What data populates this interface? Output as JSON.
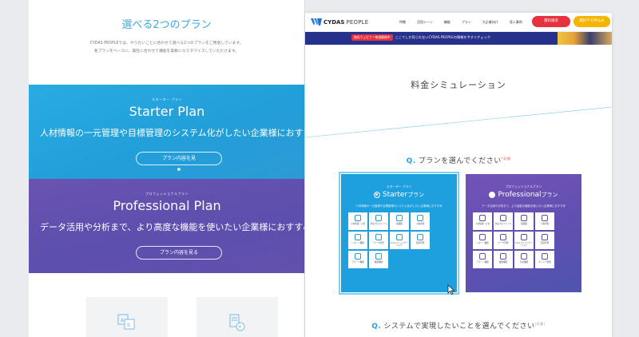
{
  "left_page": {
    "heading": "選べる2つのプラン",
    "intro_lines": [
      "CYDAS PEOPLEでは、やりたいことに合わせて選べる2つのプランをご用意しています。",
      "各プランをベースに、貴社に合わせて機能を柔軟にカスタマイズしていただけます。"
    ],
    "starter": {
      "tag": "スターター プラン",
      "name": "Starter Plan",
      "description": "人材情報の一元管理や目標管理のシステム化がしたい企業様におすすめ",
      "button": "プラン内容を見"
    },
    "professional": {
      "tag": "プロフェッショナルプラン",
      "name": "Professional Plan",
      "description": "データ活用や分析まで、より高度な機能を使いたい企業様におすすめ",
      "button": "プラン内容を見る"
    },
    "card_icons": [
      "ab-chart-icon",
      "yen-document-icon"
    ]
  },
  "right_page": {
    "logo": {
      "brand": "CYDAS",
      "product": "PEOPLE"
    },
    "nav": [
      "特徴",
      "活用シーン",
      "機能",
      "プラン",
      "大企業向け",
      "導入事例"
    ],
    "cta_primary": "資料請求",
    "cta_secondary": "無料デモ申込み",
    "banner": {
      "pill": "無料ウェビナー毎週開催中",
      "message": "ここでしか見られないCYDAS PEOPLEの情報を今すぐチェック"
    },
    "title": "料金シミュレーション",
    "question1": {
      "mark": "Q.",
      "text": "プランを選んでください",
      "note": "*必須"
    },
    "question2": {
      "mark": "Q.",
      "text": "システムで実現したいことを選んでください",
      "note": "(任意)"
    },
    "starter_card": {
      "tag": "スターター プラン",
      "name_en": "Starter",
      "name_jp": "プラン",
      "selected": true,
      "description": "人材情報の一元管理や目標管理のシステム化がしたい企業様におすすめ",
      "features": [
        "人材情報一元化",
        "社員プロファイル",
        "組織図",
        "人事評価",
        "レポート機能",
        "ワーク管理",
        "1on1コミュニケーション",
        "目標管理",
        "アラート機能",
        "履歴機能"
      ]
    },
    "pro_card": {
      "tag": "プロフェッショナルプラン",
      "name_en": "Professional",
      "name_jp": "プラン",
      "selected": false,
      "description": "データ活用や分析まで、より高度な機能を使いたい企業様におすすめ",
      "features": [
        "人材情報一元化",
        "社員プロファイル",
        "組織図",
        "人事評価",
        "レポート機能",
        "ワーク管理",
        "1on1コミュニケーション",
        "目標管理",
        "アラート機能",
        "履歴機能",
        "分析機能",
        "キャリア管理"
      ]
    }
  },
  "colors": {
    "starter_blue": "#219fd8",
    "pro_purple": "#5c4fae",
    "cta_red": "#e6323e",
    "cta_yellow": "#f5b400",
    "banner_navy": "#25318b"
  }
}
